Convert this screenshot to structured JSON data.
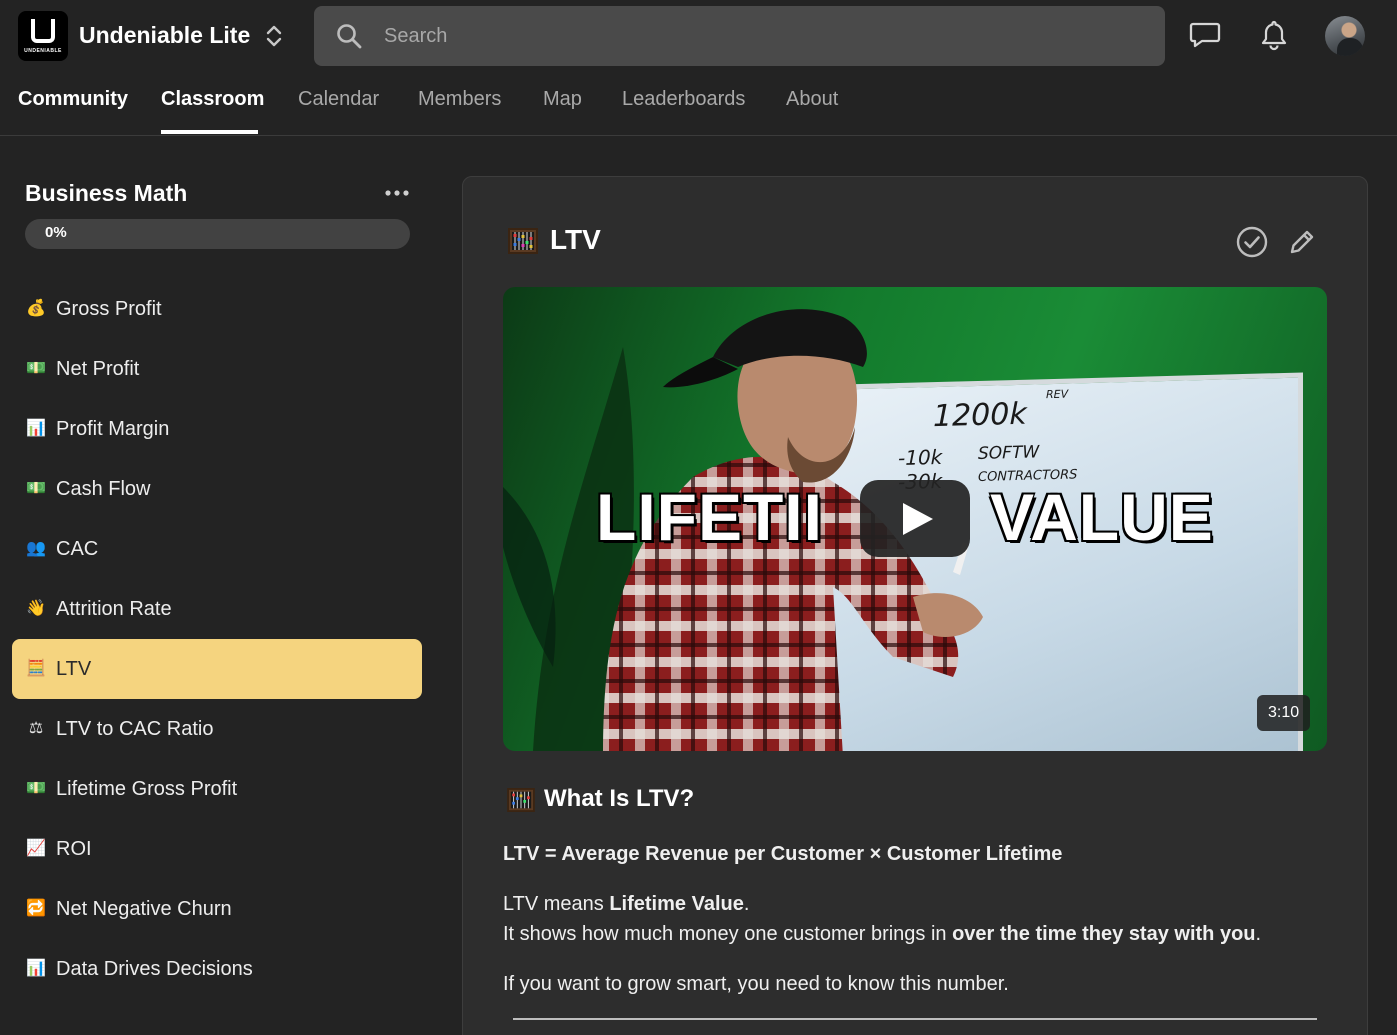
{
  "header": {
    "logo_word": "UNDENIABLE",
    "app_name": "Undeniable Lite",
    "search_placeholder": "Search",
    "icons": [
      "chat-icon",
      "bell-icon",
      "avatar"
    ]
  },
  "nav": {
    "tabs": [
      {
        "label": "Community",
        "active": false,
        "bold": true
      },
      {
        "label": "Classroom",
        "active": true,
        "bold": true
      },
      {
        "label": "Calendar",
        "active": false,
        "bold": false
      },
      {
        "label": "Members",
        "active": false,
        "bold": false
      },
      {
        "label": "Map",
        "active": false,
        "bold": false
      },
      {
        "label": "Leaderboards",
        "active": false,
        "bold": false
      },
      {
        "label": "About",
        "active": false,
        "bold": false
      }
    ]
  },
  "sidebar": {
    "course_title": "Business Math",
    "progress_label": "0%",
    "progress_value": 0,
    "lessons": [
      {
        "emoji": "💰",
        "label": "Gross Profit"
      },
      {
        "emoji": "💵",
        "label": "Net Profit"
      },
      {
        "emoji": "📊",
        "label": "Profit Margin"
      },
      {
        "emoji": "💵",
        "label": "Cash Flow"
      },
      {
        "emoji": "👥",
        "label": "CAC"
      },
      {
        "emoji": "👋",
        "label": "Attrition Rate"
      },
      {
        "emoji": "🧮",
        "label": "LTV",
        "active": true
      },
      {
        "emoji": "⚖",
        "label": "LTV to CAC Ratio"
      },
      {
        "emoji": "💵",
        "label": "Lifetime Gross Profit"
      },
      {
        "emoji": "📈",
        "label": "ROI"
      },
      {
        "emoji": "🔁",
        "label": "Net Negative Churn"
      },
      {
        "emoji": "📊",
        "label": "Data Drives Decisions"
      }
    ]
  },
  "lesson": {
    "title": "LTV",
    "video": {
      "overlay_left": "LIFETII",
      "overlay_right": "VALUE",
      "duration": "3:10",
      "whiteboard": [
        "1200k",
        "REV",
        "-10k",
        "-30k",
        "SOFTW",
        "CONTRACTORS"
      ]
    },
    "section_heading": "What Is LTV?",
    "formula": "LTV = Average Revenue per Customer × Customer Lifetime",
    "p1_pre": "LTV means ",
    "p1_bold": "Lifetime Value",
    "p1_post": ".",
    "p2_pre": "It shows how much money one customer brings in ",
    "p2_bold": "over the time they stay with you",
    "p2_post": ".",
    "p3": "If you want to grow smart, you need to know this number."
  }
}
